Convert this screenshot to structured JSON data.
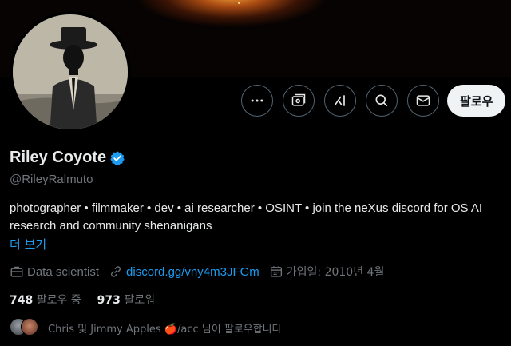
{
  "profile": {
    "name": "Riley Coyote",
    "handle": "@RileyRalmuto",
    "bio": "photographer • filmmaker • dev • ai researcher • OSINT • join the neXus discord for OS AI research and community shenanigans",
    "more_label": "더 보기",
    "profession": "Data scientist",
    "website": "discord.gg/vny4m3JFGm",
    "joined": "가입일: 2010년 4월"
  },
  "actions": {
    "more_icon": "more-dots-icon",
    "subscribe_icon": "subscribe-icon",
    "grok_icon": "grok-icon",
    "search_icon": "search-icon",
    "message_icon": "mail-icon",
    "follow_label": "팔로우"
  },
  "stats": {
    "following_count": "748",
    "following_label": "팔로우 중",
    "followers_count": "973",
    "followers_label": "팔로워"
  },
  "followed_by": {
    "text_prefix": "Chris 및 Jimmy Apples",
    "apple_emoji": "🍎",
    "text_suffix": "/acc 님이 팔로우합니다"
  },
  "colors": {
    "accent": "#1d9bf0",
    "muted": "#71767b",
    "text": "#e7e9ea"
  }
}
